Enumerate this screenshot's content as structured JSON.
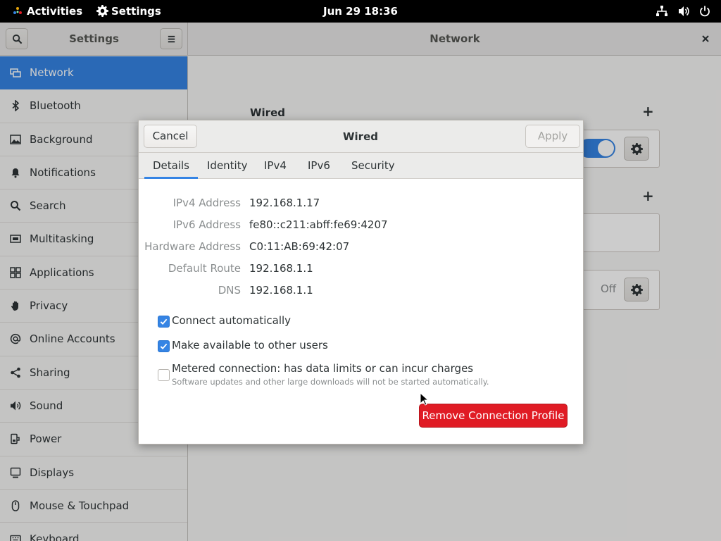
{
  "topbar": {
    "activities": "Activities",
    "app_name": "Settings",
    "clock": "Jun 29  18:36"
  },
  "window": {
    "sidebar_title": "Settings",
    "main_title": "Network"
  },
  "sidebar": {
    "items": [
      {
        "label": "Network",
        "icon": "network-icon"
      },
      {
        "label": "Bluetooth",
        "icon": "bluetooth-icon"
      },
      {
        "label": "Background",
        "icon": "background-icon"
      },
      {
        "label": "Notifications",
        "icon": "bell-icon"
      },
      {
        "label": "Search",
        "icon": "search-icon"
      },
      {
        "label": "Multitasking",
        "icon": "multitasking-icon"
      },
      {
        "label": "Applications",
        "icon": "grid-icon"
      },
      {
        "label": "Privacy",
        "icon": "hand-icon"
      },
      {
        "label": "Online Accounts",
        "icon": "at-icon"
      },
      {
        "label": "Sharing",
        "icon": "share-icon"
      },
      {
        "label": "Sound",
        "icon": "speaker-icon"
      },
      {
        "label": "Power",
        "icon": "power-plug-icon"
      },
      {
        "label": "Displays",
        "icon": "display-icon"
      },
      {
        "label": "Mouse & Touchpad",
        "icon": "mouse-icon"
      },
      {
        "label": "Keyboard",
        "icon": "keyboard-icon"
      }
    ],
    "selected": "Network"
  },
  "main": {
    "wired_title": "Wired",
    "proxy_state": "Off"
  },
  "dialog": {
    "title": "Wired",
    "cancel": "Cancel",
    "apply": "Apply",
    "tabs": [
      "Details",
      "Identity",
      "IPv4",
      "IPv6",
      "Security"
    ],
    "active_tab": "Details",
    "details": [
      {
        "label": "IPv4 Address",
        "value": "192.168.1.17"
      },
      {
        "label": "IPv6 Address",
        "value": "fe80::c211:abff:fe69:4207"
      },
      {
        "label": "Hardware Address",
        "value": "C0:11:AB:69:42:07"
      },
      {
        "label": "Default Route",
        "value": "192.168.1.1"
      },
      {
        "label": "DNS",
        "value": "192.168.1.1"
      }
    ],
    "options": {
      "connect_auto": {
        "label": "Connect automatically",
        "checked": true
      },
      "available_all": {
        "label": "Make available to other users",
        "checked": true
      },
      "metered": {
        "label": "Metered connection: has data limits or can incur charges",
        "sublabel": "Software updates and other large downloads will not be started automatically.",
        "checked": false
      }
    },
    "remove": "Remove Connection Profile"
  },
  "colors": {
    "accent": "#3584e4",
    "destructive": "#e01b24"
  }
}
